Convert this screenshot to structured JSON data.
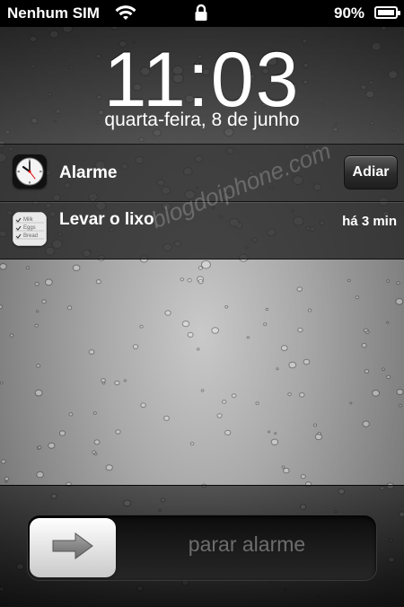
{
  "status_bar": {
    "carrier": "Nenhum SIM",
    "battery_percent": "90%",
    "battery_level": 0.9,
    "icons": [
      "wifi-icon",
      "lock-icon",
      "battery-icon"
    ]
  },
  "lock_screen": {
    "time": "11:03",
    "date": "quarta-feira, 8 de junho"
  },
  "notifications": [
    {
      "app_icon": "clock-icon",
      "title": "Alarme",
      "action_label": "Adiar"
    },
    {
      "app_icon": "reminders-icon",
      "title": "Levar o lixo",
      "time": "há 3 min",
      "reminder_items": [
        "Milk",
        "Eggs",
        "Bread"
      ]
    }
  ],
  "watermark": "blogdoiphone.com",
  "slider": {
    "label": "parar alarme",
    "icon": "arrow-right-icon"
  },
  "colors": {
    "status_bar_bg": "#000000",
    "text": "#ffffff",
    "slider_label": "#6d6d6d"
  }
}
